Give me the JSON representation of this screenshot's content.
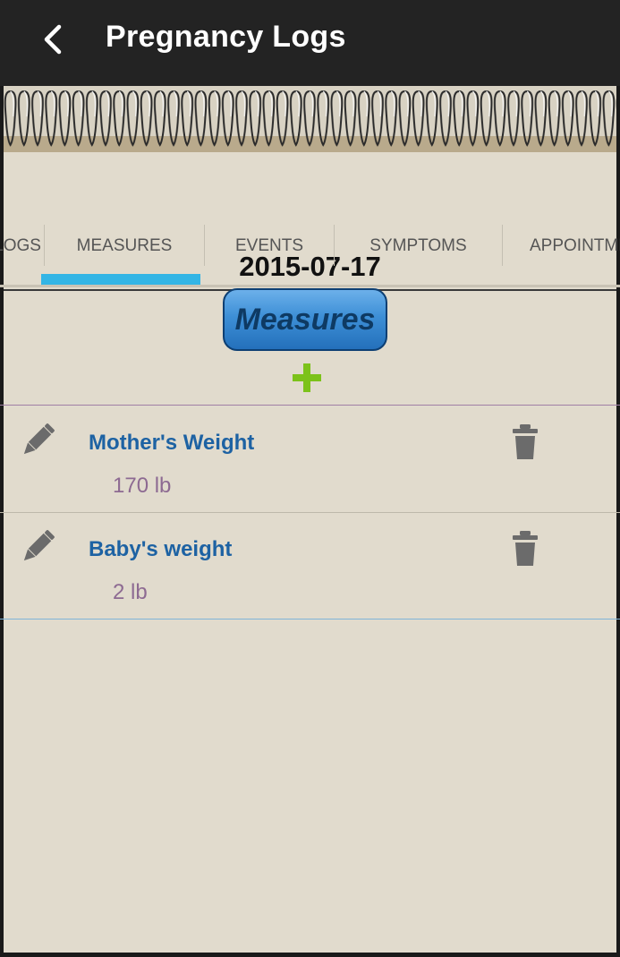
{
  "header": {
    "title": "Pregnancy Logs"
  },
  "log": {
    "date": "2015-07-17"
  },
  "tabs": [
    {
      "label": "LOGS"
    },
    {
      "label": "MEASURES",
      "active": true
    },
    {
      "label": "EVENTS"
    },
    {
      "label": "SYMPTOMS"
    },
    {
      "label": "APPOINTMENTS"
    }
  ],
  "section": {
    "label": "Measures"
  },
  "measures": [
    {
      "name": "Mother's Weight",
      "value": "170 lb"
    },
    {
      "name": "Baby's weight",
      "value": "2 lb"
    }
  ],
  "icons": {
    "back": "chevron-left-icon",
    "add": "plus-icon",
    "edit": "pencil-icon",
    "delete": "trash-icon"
  },
  "colors": {
    "header_bg": "#232323",
    "paper_bg": "#e1dbcd",
    "tab_indicator": "#33b5e5",
    "section_button": "#2f80c9",
    "measure_name": "#1d62a3",
    "measure_value": "#8d6a92",
    "add_icon": "#7cc21a"
  }
}
